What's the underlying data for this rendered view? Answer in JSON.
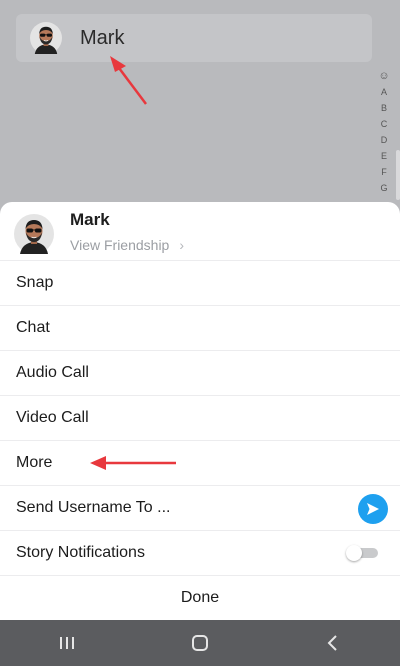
{
  "background": {
    "friend_name": "Mark",
    "alpha_index": [
      "☺",
      "A",
      "B",
      "C",
      "D",
      "E",
      "F",
      "G"
    ]
  },
  "sheet": {
    "name": "Mark",
    "subtitle": "View Friendship",
    "subtitle_chevron": "›",
    "items": [
      {
        "label": "Snap"
      },
      {
        "label": "Chat"
      },
      {
        "label": "Audio Call"
      },
      {
        "label": "Video Call"
      },
      {
        "label": "More"
      },
      {
        "label": "Send Username To ..."
      },
      {
        "label": "Story Notifications"
      }
    ],
    "done_label": "Done"
  },
  "colors": {
    "send_button": "#1ea0ef",
    "annotation_arrow": "#e8383d",
    "nav_bar": "#5b5c5f"
  },
  "icons": {
    "avatar": "bitmoji-avatar-icon",
    "send": "send-arrow-icon",
    "nav_recent": "recent-apps-icon",
    "nav_home": "home-icon",
    "nav_back": "back-icon"
  },
  "states": {
    "story_notifications_enabled": false
  }
}
